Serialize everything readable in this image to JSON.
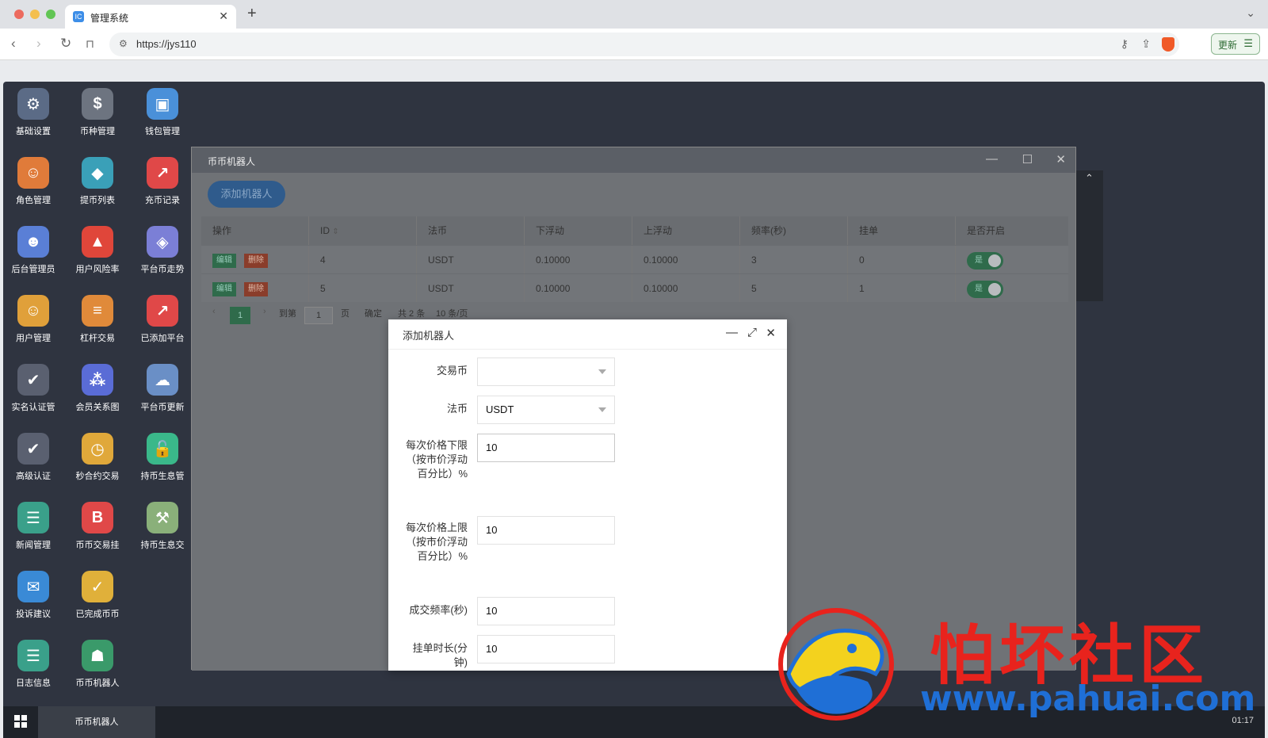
{
  "browser": {
    "tab_title": "管理系统",
    "tab_favicon": "IC",
    "url": "https://jys110",
    "update_label": "更新"
  },
  "desktop_icons": [
    {
      "label": "基础设置",
      "icon": "gear-icon",
      "color": "#5b6b86",
      "glyph": "⚙"
    },
    {
      "label": "币种管理",
      "icon": "dollar-icon",
      "color": "#6d7480",
      "glyph": "$"
    },
    {
      "label": "钱包管理",
      "icon": "wallet-icon",
      "color": "#4a90d9",
      "glyph": "▣"
    },
    {
      "label": "角色管理",
      "icon": "role-icon",
      "color": "#e07b3a",
      "glyph": "☺"
    },
    {
      "label": "提币列表",
      "icon": "withdraw-icon",
      "color": "#3aa0b8",
      "glyph": "◆"
    },
    {
      "label": "充币记录",
      "icon": "deposit-record-icon",
      "color": "#e04848",
      "glyph": "↗"
    },
    {
      "label": "后台管理员",
      "icon": "admin-icon",
      "color": "#5a7fd6",
      "glyph": "☻"
    },
    {
      "label": "用户风险率",
      "icon": "alarm-icon",
      "color": "#e0463a",
      "glyph": "▲"
    },
    {
      "label": "平台币走势",
      "icon": "layers-icon",
      "color": "#7b7fd6",
      "glyph": "◈"
    },
    {
      "label": "用户管理",
      "icon": "user-search-icon",
      "color": "#e0a03a",
      "glyph": "☺"
    },
    {
      "label": "杠杆交易",
      "icon": "stack-icon",
      "color": "#e08a3a",
      "glyph": "≡"
    },
    {
      "label": "已添加平台",
      "icon": "trend-icon",
      "color": "#e04848",
      "glyph": "↗"
    },
    {
      "label": "实名认证管",
      "icon": "verify-icon",
      "color": "#5a6070",
      "glyph": "✔"
    },
    {
      "label": "会员关系图",
      "icon": "network-icon",
      "color": "#5a6cd6",
      "glyph": "⁂"
    },
    {
      "label": "平台币更新",
      "icon": "cloud-refresh-icon",
      "color": "#6a8fc6",
      "glyph": "☁"
    },
    {
      "label": "高级认证",
      "icon": "advanced-verify-icon",
      "color": "#5a6070",
      "glyph": "✔"
    },
    {
      "label": "秒合约交易",
      "icon": "stopwatch-icon",
      "color": "#e0a83a",
      "glyph": "◷"
    },
    {
      "label": "持币生息管",
      "icon": "unlock-icon",
      "color": "#3ab88a",
      "glyph": "🔓"
    },
    {
      "label": "新闻管理",
      "icon": "news-icon",
      "color": "#3aa08a",
      "glyph": "☰"
    },
    {
      "label": "币币交易挂",
      "icon": "bitcoin-bag-icon",
      "color": "#e04848",
      "glyph": "B"
    },
    {
      "label": "持币生息交",
      "icon": "hammer-icon",
      "color": "#8ab07a",
      "glyph": "⚒"
    },
    {
      "label": "投诉建议",
      "icon": "mail-icon",
      "color": "#3a8ad6",
      "glyph": "✉"
    },
    {
      "label": "已完成币币",
      "icon": "check-box-icon",
      "color": "#e0b03a",
      "glyph": "✓"
    },
    null,
    {
      "label": "日志信息",
      "icon": "log-icon",
      "color": "#3aa08a",
      "glyph": "☰"
    },
    {
      "label": "币币机器人",
      "icon": "robot-icon",
      "color": "#3a9a6a",
      "glyph": "☗"
    },
    null
  ],
  "main_window": {
    "title": "币币机器人",
    "add_button": "添加机器人",
    "columns": [
      "操作",
      "ID",
      "法币",
      "下浮动",
      "上浮动",
      "频率(秒)",
      "挂单",
      "是否开启"
    ],
    "edit_label": "编辑",
    "delete_label": "删除",
    "toggle_label": "是",
    "rows": [
      {
        "id": "4",
        "fiat": "USDT",
        "down": "0.10000",
        "up": "0.10000",
        "freq": "3",
        "order": "0"
      },
      {
        "id": "5",
        "fiat": "USDT",
        "down": "0.10000",
        "up": "0.10000",
        "freq": "5",
        "order": "1"
      }
    ],
    "pager": {
      "current": "1",
      "goto_label": "到第",
      "page_input": "1",
      "page_unit": "页",
      "confirm": "确定",
      "total": "共 2 条",
      "per_page": "10 条/页"
    }
  },
  "dialog": {
    "title": "添加机器人",
    "fields": [
      {
        "label": "交易币",
        "value": "",
        "type": "select"
      },
      {
        "label": "法币",
        "value": "USDT",
        "type": "select"
      },
      {
        "label": "每次价格下限（按市价浮动百分比）%",
        "value": "10",
        "type": "input"
      },
      {
        "label": "每次价格上限（按市价浮动百分比）%",
        "value": "10",
        "type": "input"
      },
      {
        "label": "成交频率(秒)",
        "value": "10",
        "type": "input"
      },
      {
        "label": "挂单时长(分钟)",
        "value": "10",
        "type": "input"
      }
    ]
  },
  "taskbar": {
    "task_item": "币币机器人",
    "clock": "01:17"
  },
  "watermark": {
    "text": "怕坏社区",
    "url": "www.pahuai.com"
  }
}
